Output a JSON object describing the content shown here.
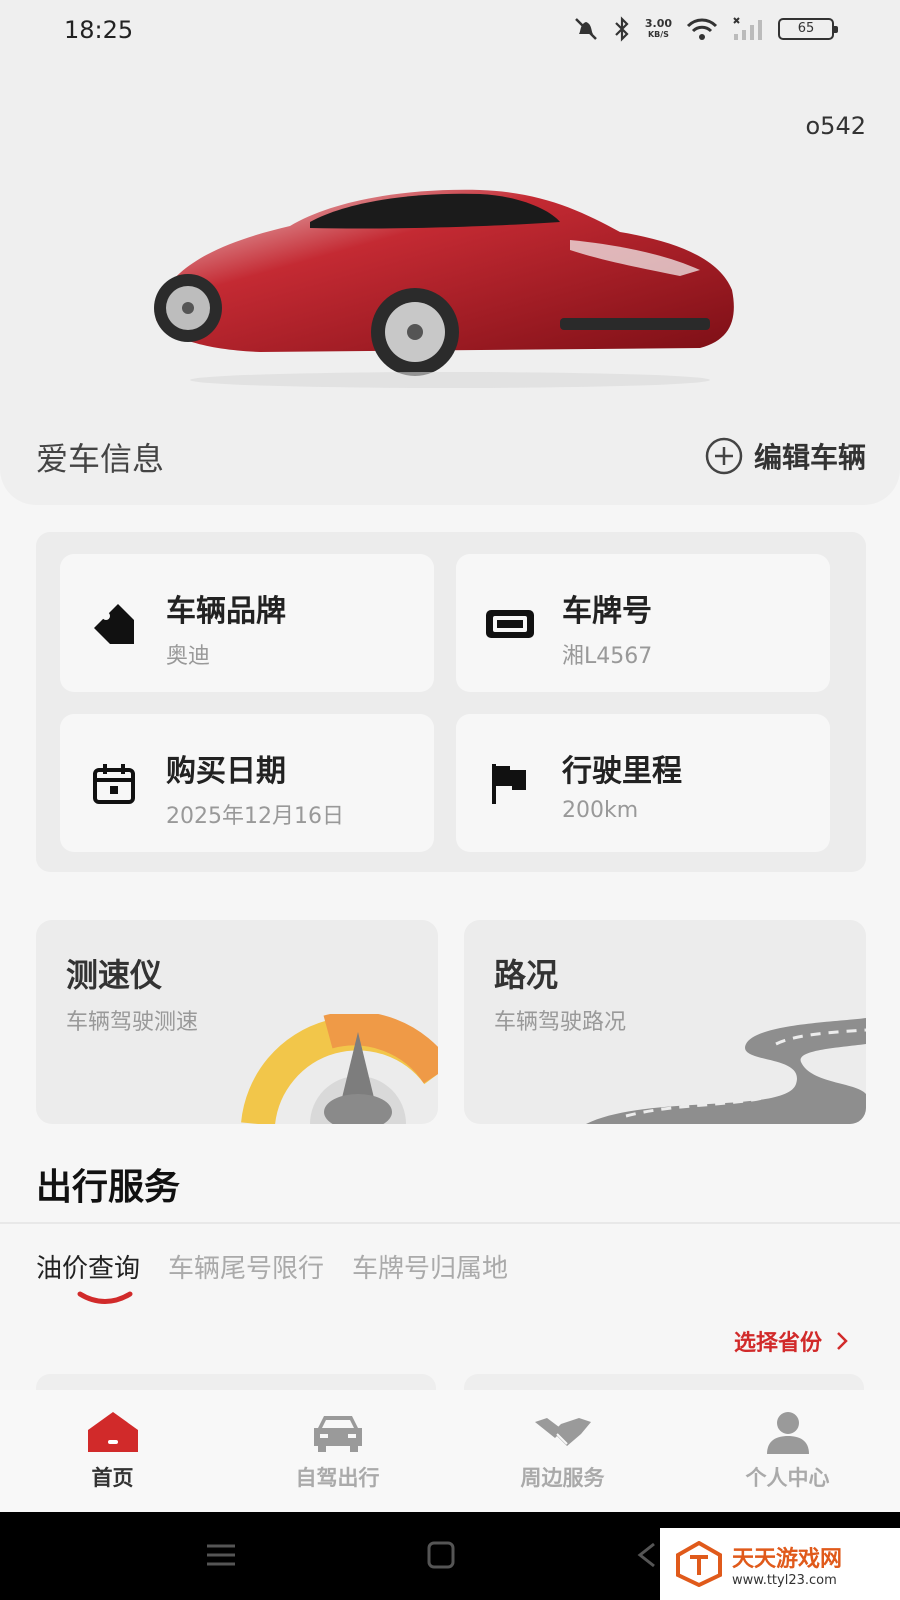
{
  "status_bar": {
    "time": "18:25",
    "net_speed_value": "3.00",
    "net_speed_unit": "KB/S",
    "battery": "65"
  },
  "hero": {
    "user_code": "o542",
    "car_info_title": "爱车信息",
    "edit_vehicle_label": "编辑车辆"
  },
  "info_cards": [
    {
      "label": "车辆品牌",
      "value": "奥迪",
      "icon": "tag-icon"
    },
    {
      "label": "车牌号",
      "value": "湘L4567",
      "icon": "license-plate-icon"
    },
    {
      "label": "购买日期",
      "value": "2025年12月16日",
      "icon": "calendar-icon"
    },
    {
      "label": "行驶里程",
      "value": "200km",
      "icon": "flag-icon"
    }
  ],
  "features": [
    {
      "title": "测速仪",
      "subtitle": "车辆驾驶测速"
    },
    {
      "title": "路况",
      "subtitle": "车辆驾驶路况"
    }
  ],
  "services": {
    "title": "出行服务",
    "tabs": [
      "油价查询",
      "车辆尾号限行",
      "车牌号归属地"
    ],
    "active_tab": 0,
    "choose_province": "选择省份"
  },
  "bottom_nav": [
    {
      "label": "首页",
      "icon": "home-icon",
      "active": true
    },
    {
      "label": "自驾出行",
      "icon": "car-icon",
      "active": false
    },
    {
      "label": "周边服务",
      "icon": "handshake-icon",
      "active": false
    },
    {
      "label": "个人中心",
      "icon": "person-icon",
      "active": false
    }
  ],
  "watermark": {
    "name": "天天游戏网",
    "url": "www.ttyl23.com"
  },
  "colors": {
    "accent": "#d12a2a",
    "background": "#f6f6f6",
    "panel": "#ececec"
  }
}
